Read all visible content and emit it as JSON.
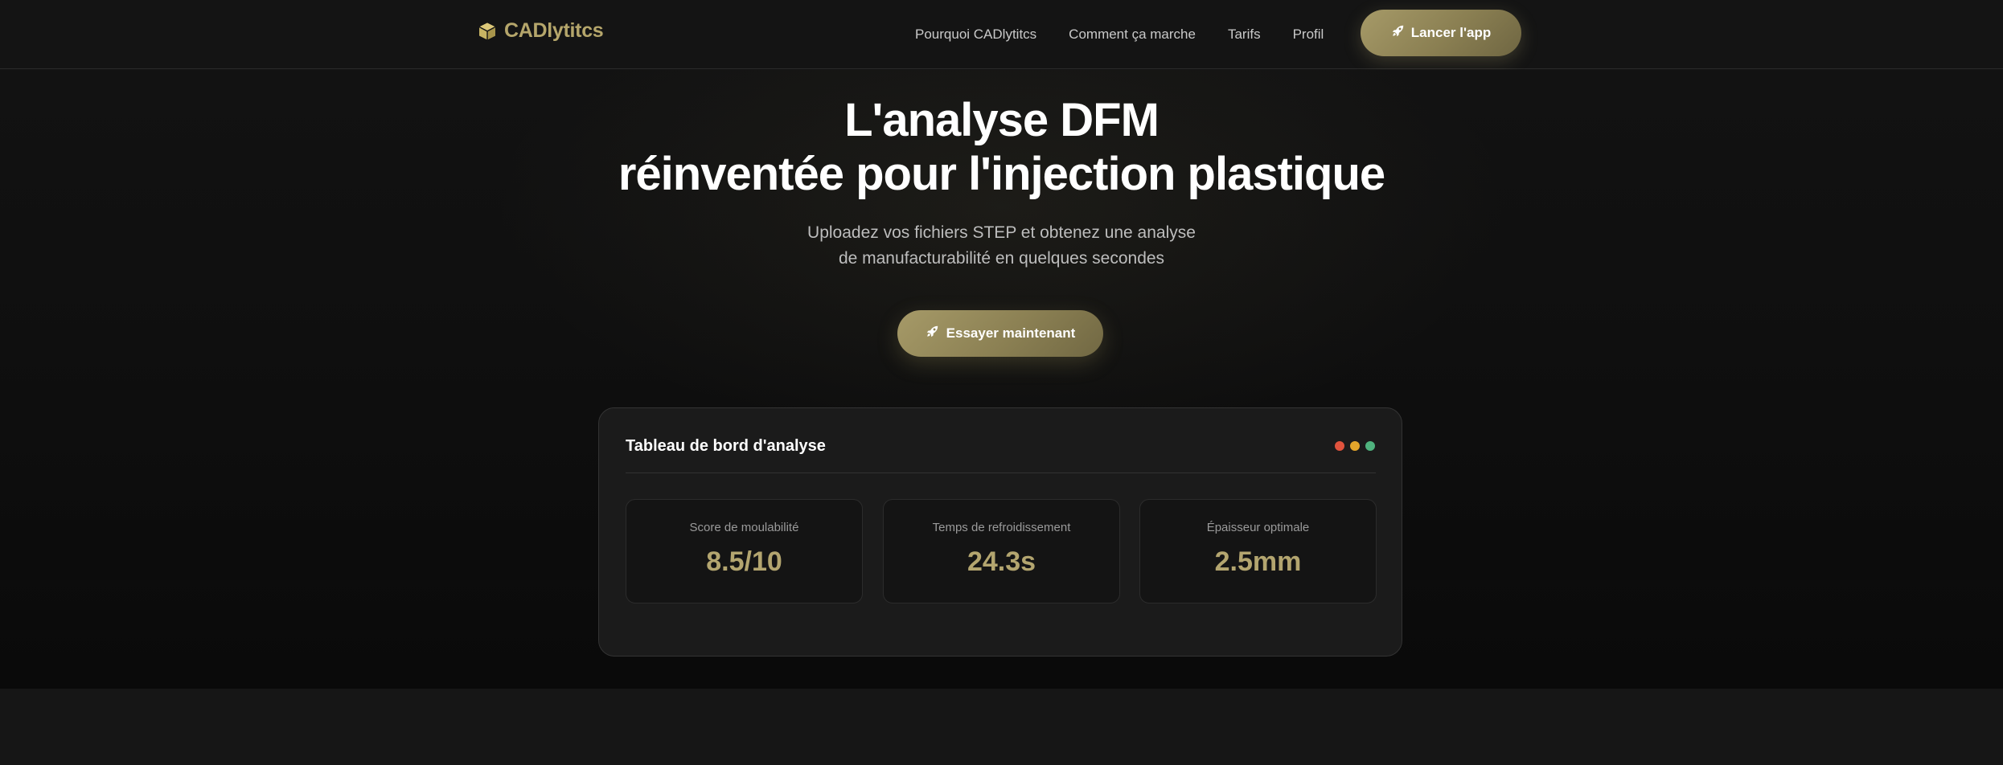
{
  "brand": {
    "name": "CADlytitcs",
    "icon": "cube-icon",
    "color": "#b5a66b"
  },
  "nav": {
    "links": [
      "Pourquoi CADlytitcs",
      "Comment ça marche",
      "Tarifs",
      "Profil"
    ],
    "cta_label": "Lancer l'app",
    "cta_icon": "rocket-icon"
  },
  "hero": {
    "title_line1": "L'analyse DFM",
    "title_line2": "réinventée pour l'injection plastique",
    "subtitle_line1": "Uploadez vos fichiers STEP et obtenez une analyse",
    "subtitle_line2": "de manufacturabilité en quelques secondes",
    "cta_label": "Essayer maintenant",
    "cta_icon": "rocket-icon"
  },
  "dashboard": {
    "title": "Tableau de bord d'analyse",
    "window_dots": [
      "#e0533d",
      "#e3a52b",
      "#4fb37e"
    ],
    "metrics": [
      {
        "label": "Score de moulabilité",
        "value": "8.5/10"
      },
      {
        "label": "Temps de refroidissement",
        "value": "24.3s"
      },
      {
        "label": "Épaisseur optimale",
        "value": "2.5mm"
      }
    ]
  },
  "colors": {
    "accent": "#a69a68",
    "background": "#0f0f0f",
    "card": "#1b1b1b"
  }
}
